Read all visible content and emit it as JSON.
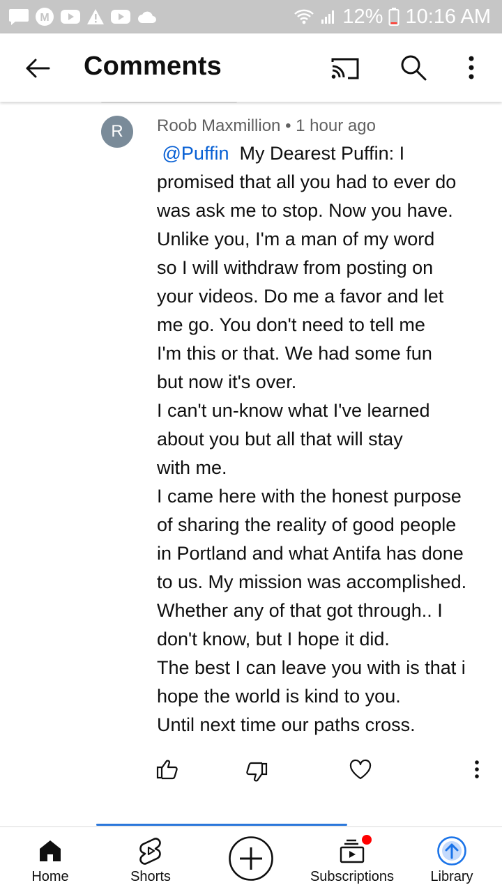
{
  "status_bar": {
    "battery": "12%",
    "time": "10:16 AM"
  },
  "header": {
    "title": "Comments"
  },
  "comment": {
    "avatar_initial": "R",
    "author": "Roob Maxmillion",
    "separator": "•",
    "time_ago": "1 hour ago",
    "mention": "@Puffin",
    "lines": [
      "My Dearest Puffin: I",
      "promised that all you had to ever do",
      "was ask me to stop.  Now you have.",
      "Unlike you, I'm a man of my word",
      "so I will withdraw from posting on",
      "your videos.  Do me a favor and let",
      "me go.  You don't need to tell me",
      "I'm this or that.  We had some fun",
      "but now it's over.",
      "I can't un-know what I've learned",
      "about you but all that will stay",
      "with me.",
      "I came here with the honest purpose",
      "of sharing the reality of good people",
      "in Portland and what Antifa has done",
      "to us. My mission was accomplished.",
      "Whether any of that got through..  I",
      "don't know, but I hope it did.",
      "The best I can leave you with is that i",
      "hope the world is kind to you.",
      "Until next time our paths cross."
    ]
  },
  "bottom_nav": {
    "home": "Home",
    "shorts": "Shorts",
    "subscriptions": "Subscriptions",
    "library": "Library"
  },
  "colors": {
    "status_bar": "#c6c6c6",
    "link": "#065fd4",
    "notification": "#ff0000",
    "avatar": "#7a8b99",
    "library_accent": "#1a73e8"
  },
  "icons": {
    "back": "arrow-left-icon",
    "cast": "cast-icon",
    "search": "search-icon",
    "more": "more-vert-icon",
    "like": "thumb-up-icon",
    "dislike": "thumb-down-icon",
    "heart": "heart-icon",
    "home": "home-icon",
    "shorts": "shorts-icon",
    "create": "add-circle-icon",
    "subscriptions": "subscriptions-icon",
    "library": "library-icon"
  }
}
